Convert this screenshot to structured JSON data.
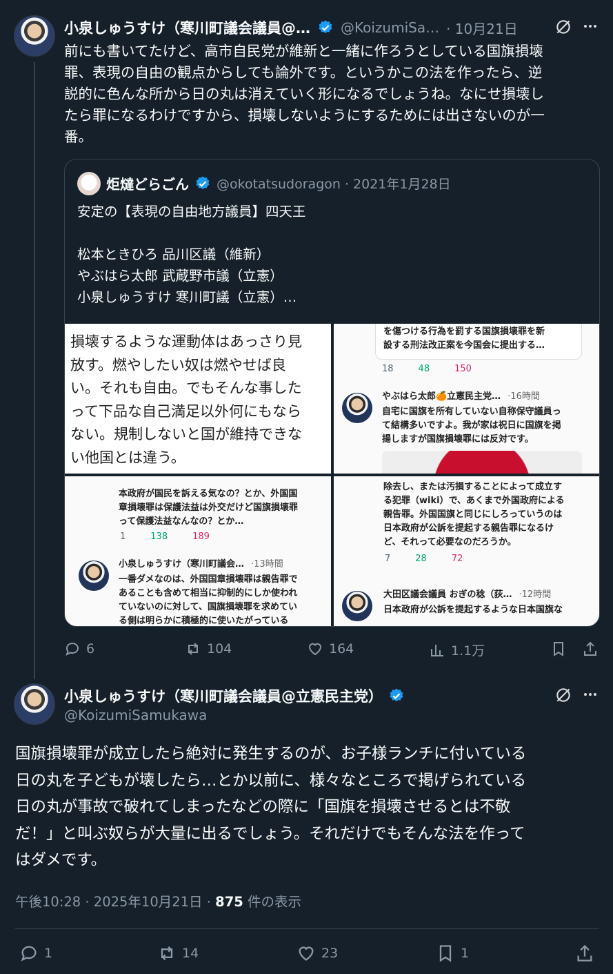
{
  "tweet1": {
    "display_name": "小泉しゅうすけ（寒川町議会議員@…",
    "handle": "@KoizumiSa…",
    "date": "· 10月21日",
    "body": "前にも書いてたけど、高市自民党が維新と一緒に作ろうとしている国旗損壊\n罪、表現の自由の観点からしても論外です。というかこの法を作ったら、逆\n説的に色んな所から日の丸は消えていく形になるでしょうね。なにせ損壊し\nたら罪になるわけですから、損壊しないようにするためには出さないのが一\n番。",
    "quote": {
      "display_name": "炬燵どらごん",
      "handle_date": "@okotatsudoragon · 2021年1月28日",
      "body": "安定の【表現の自由地方議員】四天王\n\n松本ときひろ 品川区議（維新）\nやぶはら太郎 武蔵野市議（立憲）\n小泉しゅうすけ 寒川町議（立憲）…",
      "img1_text": "損壊するような運動体はあっさり見\n放す。燃やしたい奴は燃やせば良\nい。それも自由。でもそんな事した\nって下品な自己満足以外何にもなら\nない。規制しないと国が維持できな\nい他国とは違う。",
      "img2": {
        "top_text": "を傷つける行為を罰する国旗損壊罪を新\n設する刑法改正案を今国会に提出する…",
        "metrics": [
          "18",
          "48",
          "150"
        ],
        "name": "やぶはら太郎🍊立憲民主党…",
        "time": "·16時間",
        "body": "自宅に国旗を所有していない自称保守議員っ\nて結構多いですよ。我が家は祝日に国旗を掲\n揚しますが国旗損壊罪には反対です。"
      },
      "img3": {
        "top_text": "本政府が国民を訴える気なの？とか、外国国\n章損壊罪は保護法益は外交だけど国旗損壊罪\nって保護法益なんなの？とか…",
        "metrics": [
          "1",
          "138",
          "189"
        ],
        "name": "小泉しゅうすけ（寒川町議会…",
        "time": "·13時間",
        "body": "一番ダメなのは、外国国章損壊罪は親告罪で\nあることも含めて相当に抑制的にしか使われ\nていないのに対して、国旗損壊罪を求めてい\nる側は明らかに積極的に使いたがっている"
      },
      "img4": {
        "top_text": "除去し、または汚損することによって成立す\nる犯罪（wiki）で、あくまで外国政府による\n親告罪。外国国旗と同じにしろっていうのは\n日本政府が公訴を提起する親告罪になるけ\nど、それって必要なのだろうか。",
        "metrics": [
          "7",
          "28",
          "72"
        ],
        "name": "大田区議会議員 おぎの稔（荻…",
        "time": "·12時間",
        "body": "日本政府が公訴を提起するような日本国旗な"
      }
    },
    "replies": "6",
    "retweets": "104",
    "likes": "164",
    "views": "1.1万"
  },
  "tweet2": {
    "display_name": "小泉しゅうすけ（寒川町議会議員@立憲民主党）",
    "handle": "@KoizumiSamukawa",
    "body": "国旗損壊罪が成立したら絶対に発生するのが、お子様ランチに付いている\n日の丸を子どもが壊したら…とか以前に、様々なところで掲げられている\n日の丸が事故で破れてしまったなどの際に「国旗を損壊させるとは不敬\nだ！」と叫ぶ奴らが大量に出るでしょう。それだけでもそんな法を作って\nはダメです。",
    "timestamp": "午後10:28 · 2025年10月21日 · ",
    "views_count": "875",
    "views_label": " 件の表示",
    "replies": "1",
    "retweets": "14",
    "likes": "23",
    "bookmarks": "1"
  },
  "colors": {
    "background": "#15202b",
    "verified": "#1d9bf0",
    "text": "#f7f9f9",
    "muted": "#8b98a5"
  }
}
